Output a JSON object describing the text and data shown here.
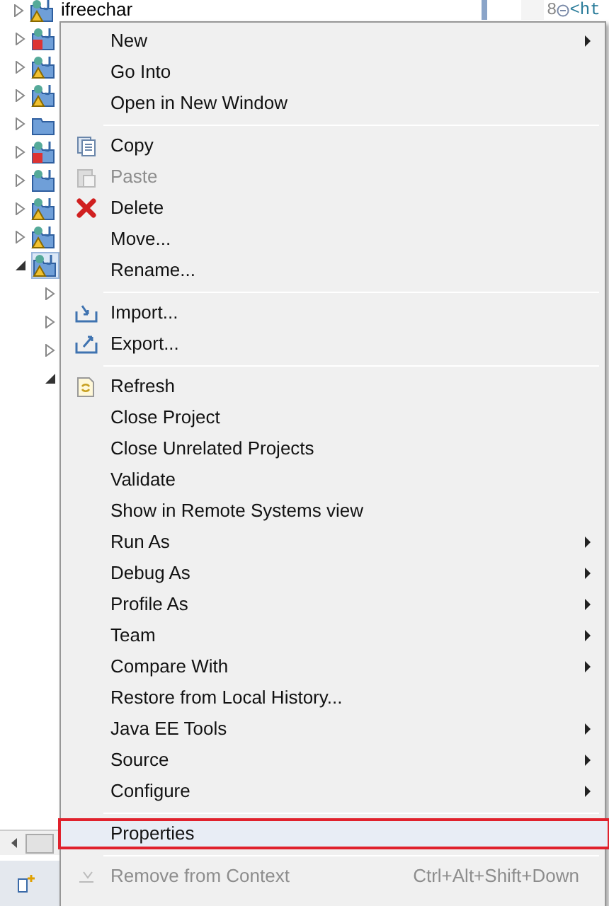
{
  "editor": {
    "line_number": "8",
    "code": "<ht"
  },
  "tree": [
    {
      "label": "ifreechar",
      "kind": "warning",
      "expanded": false,
      "selected": false
    },
    {
      "kind": "error",
      "expanded": false,
      "selected": false
    },
    {
      "kind": "warning",
      "expanded": false,
      "selected": false
    },
    {
      "kind": "warning",
      "expanded": false,
      "selected": false
    },
    {
      "kind": "folder",
      "expanded": false,
      "selected": false
    },
    {
      "kind": "error",
      "expanded": false,
      "selected": false
    },
    {
      "kind": "plain",
      "expanded": false,
      "selected": false
    },
    {
      "kind": "warning",
      "expanded": false,
      "selected": false
    },
    {
      "kind": "warning",
      "expanded": false,
      "selected": false
    },
    {
      "kind": "warning",
      "expanded": true,
      "selected": true,
      "children": [
        {
          "expanded": false
        },
        {
          "expanded": false
        },
        {
          "expanded": false
        },
        {
          "expanded": true
        }
      ]
    }
  ],
  "menu": [
    {
      "items": [
        {
          "label": "New",
          "submenu": true
        },
        {
          "label": "Go Into"
        },
        {
          "label": "Open in New Window"
        }
      ]
    },
    {
      "items": [
        {
          "label": "Copy",
          "kind": "copy"
        },
        {
          "label": "Paste",
          "kind": "paste",
          "disabled": true
        },
        {
          "label": "Delete",
          "kind": "delete"
        },
        {
          "label": "Move..."
        },
        {
          "label": "Rename..."
        }
      ]
    },
    {
      "items": [
        {
          "label": "Import...",
          "kind": "import"
        },
        {
          "label": "Export...",
          "kind": "export"
        }
      ]
    },
    {
      "items": [
        {
          "label": "Refresh",
          "kind": "refresh"
        },
        {
          "label": "Close Project"
        },
        {
          "label": "Close Unrelated Projects"
        },
        {
          "label": "Validate"
        },
        {
          "label": "Show in Remote Systems view"
        },
        {
          "label": "Run As",
          "submenu": true
        },
        {
          "label": "Debug As",
          "submenu": true
        },
        {
          "label": "Profile As",
          "submenu": true
        },
        {
          "label": "Team",
          "submenu": true
        },
        {
          "label": "Compare With",
          "submenu": true
        },
        {
          "label": "Restore from Local History..."
        },
        {
          "label": "Java EE Tools",
          "submenu": true
        },
        {
          "label": "Source",
          "submenu": true
        },
        {
          "label": "Configure",
          "submenu": true
        }
      ]
    },
    {
      "items": [
        {
          "label": "Properties",
          "selected": true
        }
      ]
    },
    {
      "items": [
        {
          "label": "Remove from Context",
          "kind": "context",
          "disabled": true,
          "shortcut": "Ctrl+Alt+Shift+Down"
        }
      ]
    }
  ]
}
